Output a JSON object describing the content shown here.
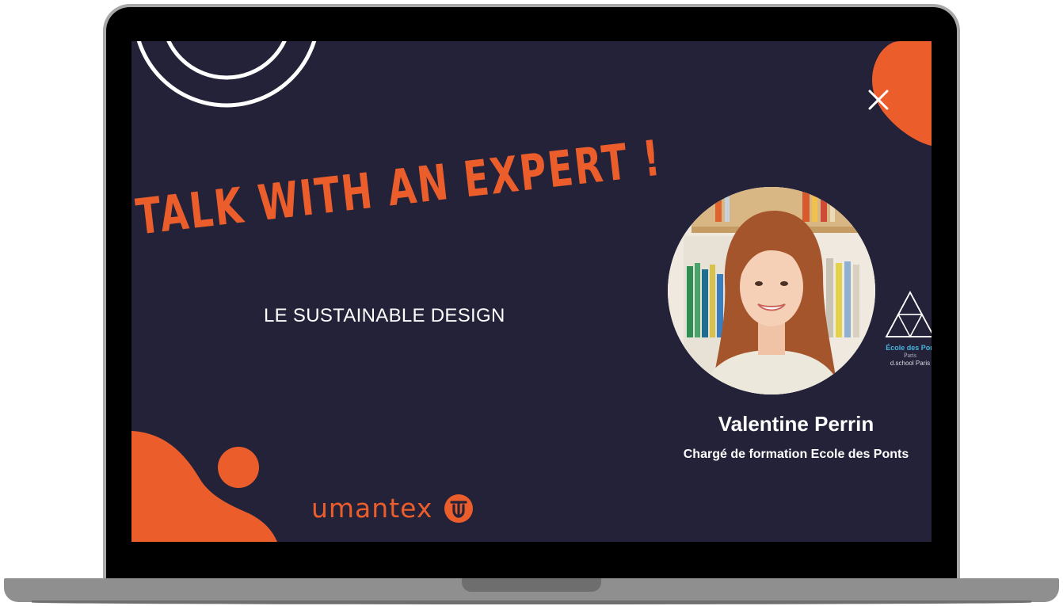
{
  "slide": {
    "headline": "TALK WITH AN EXPERT !",
    "subtitle": "LE SUSTAINABLE DESIGN",
    "brand": "umantex",
    "expert": {
      "name": "Valentine Perrin",
      "role": "Chargé de formation Ecole des Ponts"
    },
    "school": {
      "name": "École des Pon",
      "city": "Paris",
      "sub": "d.school Paris"
    }
  },
  "colors": {
    "accent": "#eb5e2c",
    "screen_bg": "#242238",
    "text": "#ffffff",
    "school_blue": "#48b3dd",
    "bezel": "#000000",
    "laptop_base": "#8f8f8f"
  },
  "icons": {
    "brand_logo": "umantex-logo-icon",
    "close": "close-icon",
    "school_logo": "triangle-logo-icon"
  }
}
